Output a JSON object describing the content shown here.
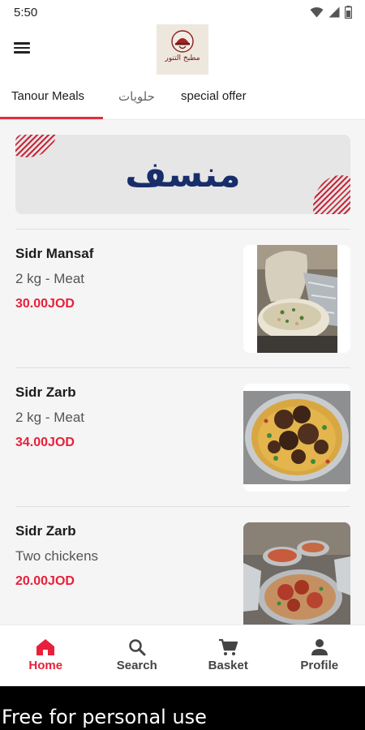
{
  "status_bar": {
    "time": "5:50"
  },
  "app_bar": {
    "logo_text": "مطبخ التنور"
  },
  "tabs": [
    {
      "label": "Tanour Meals"
    },
    {
      "label": "حلويات"
    },
    {
      "label": "special offer"
    }
  ],
  "banner": {
    "title": "منسف"
  },
  "meals": [
    {
      "name": "Sidr Mansaf",
      "description": "2 kg - Meat",
      "price": "30.00JOD"
    },
    {
      "name": "Sidr Zarb",
      "description": "2 kg - Meat",
      "price": "34.00JOD"
    },
    {
      "name": "Sidr Zarb",
      "description": "Two chickens",
      "price": "20.00JOD"
    }
  ],
  "bottom_nav": [
    {
      "label": "Home",
      "icon": "home-icon"
    },
    {
      "label": "Search",
      "icon": "search-icon"
    },
    {
      "label": "Basket",
      "icon": "cart-icon"
    },
    {
      "label": "Profile",
      "icon": "person-icon"
    }
  ],
  "watermark": {
    "text": "Free for personal use"
  },
  "colors": {
    "accent": "#e8203a",
    "banner_text": "#182e6a",
    "stripes": "#c8283a"
  }
}
